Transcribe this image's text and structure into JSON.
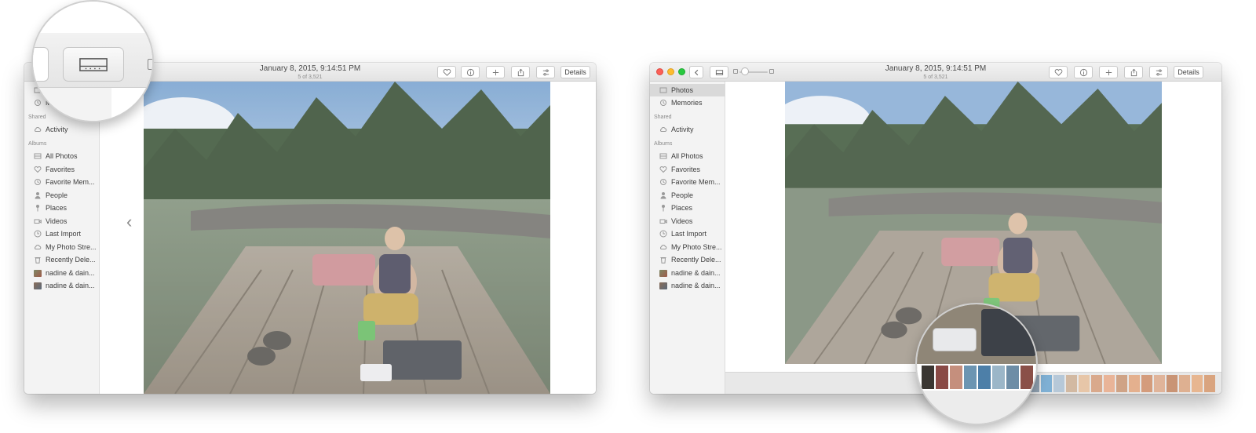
{
  "title": {
    "date": "January 8, 2015, 9:14:51 PM",
    "count": "5 of 3,521"
  },
  "toolbar": {
    "details_label": "Details"
  },
  "sidebar": {
    "top_items": [
      {
        "label": "Photos",
        "icon": "photos-icon"
      },
      {
        "label": "Memories",
        "icon": "memories-icon"
      }
    ],
    "shared_header": "Shared",
    "shared_items": [
      {
        "label": "Activity",
        "icon": "cloud-icon"
      }
    ],
    "albums_header": "Albums",
    "album_items": [
      {
        "label": "All Photos",
        "icon": "all-photos-icon"
      },
      {
        "label": "Favorites",
        "icon": "heart-icon"
      },
      {
        "label": "Favorite Mem...",
        "icon": "memories-icon"
      },
      {
        "label": "People",
        "icon": "person-icon"
      },
      {
        "label": "Places",
        "icon": "pin-icon"
      },
      {
        "label": "Videos",
        "icon": "video-icon"
      },
      {
        "label": "Last Import",
        "icon": "clock-icon"
      },
      {
        "label": "My Photo Stre...",
        "icon": "cloud-icon"
      },
      {
        "label": "Recently Dele...",
        "icon": "trash-icon"
      },
      {
        "label": "nadine & dain...",
        "icon": "album-thumbnail"
      },
      {
        "label": "nadine & dain...",
        "icon": "album-thumbnail"
      }
    ]
  },
  "colors": {
    "selected_row": "#d9d9d9",
    "sidebar_bg": "#f3f3f3",
    "titlebar_bg": "#e6e6e6"
  }
}
